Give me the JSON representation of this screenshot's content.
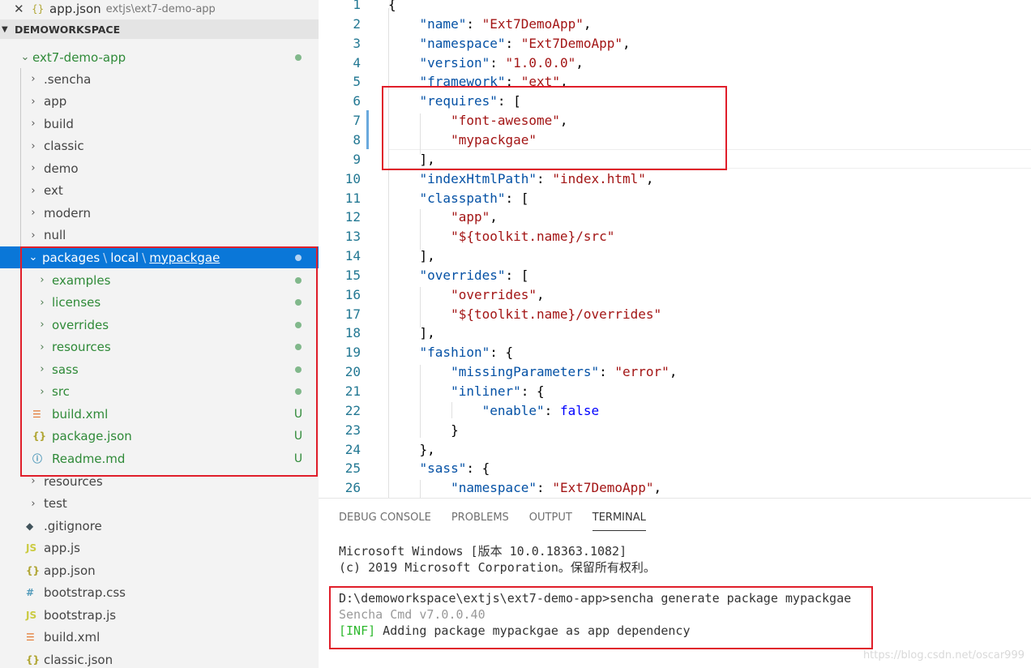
{
  "open_editor": {
    "name": "app.json",
    "path": "extjs\\ext7-demo-app"
  },
  "workspace": {
    "title": "DEMOWORKSPACE"
  },
  "tree": {
    "root": "ext7-demo-app",
    "folders_top": [
      ".sencha",
      "app",
      "build",
      "classic",
      "demo",
      "ext",
      "modern",
      "null"
    ],
    "selected": {
      "part1": "packages",
      "sep": "\\",
      "part2": "local",
      "part3": "mypackgae"
    },
    "package_children": [
      {
        "label": "examples",
        "status": "dot"
      },
      {
        "label": "licenses",
        "status": "dot"
      },
      {
        "label": "overrides",
        "status": "dot"
      },
      {
        "label": "resources",
        "status": "dot"
      },
      {
        "label": "sass",
        "status": "dot"
      },
      {
        "label": "src",
        "status": "dot"
      },
      {
        "label": "build.xml",
        "status": "U",
        "icon": "rss-icon"
      },
      {
        "label": "package.json",
        "status": "U",
        "icon": "json-icon",
        "icon_text": "{}"
      },
      {
        "label": "Readme.md",
        "status": "U",
        "icon": "info-icon",
        "icon_text": "ⓘ"
      }
    ],
    "folders_bottom": [
      "resources",
      "test"
    ],
    "files_bottom": [
      {
        "label": ".gitignore",
        "icon": "git-icon",
        "icon_text": "◆"
      },
      {
        "label": "app.js",
        "icon": "js-icon",
        "icon_text": "JS"
      },
      {
        "label": "app.json",
        "icon": "json-icon",
        "icon_text": "{}"
      },
      {
        "label": "bootstrap.css",
        "icon": "css-icon",
        "icon_text": "#"
      },
      {
        "label": "bootstrap.js",
        "icon": "js-icon",
        "icon_text": "JS"
      },
      {
        "label": "build.xml",
        "icon": "rss-icon",
        "icon_text": "☰"
      },
      {
        "label": "classic.json",
        "icon": "json-icon",
        "icon_text": "{}"
      }
    ]
  },
  "editor": {
    "lines": [
      "{",
      "    \"name\": \"Ext7DemoApp\",",
      "    \"namespace\": \"Ext7DemoApp\",",
      "    \"version\": \"1.0.0.0\",",
      "    \"framework\": \"ext\",",
      "    \"requires\": [",
      "        \"font-awesome\",",
      "        \"mypackgae\"",
      "    ],",
      "    \"indexHtmlPath\": \"index.html\",",
      "    \"classpath\": [",
      "        \"app\",",
      "        \"${toolkit.name}/src\"",
      "    ],",
      "    \"overrides\": [",
      "        \"overrides\",",
      "        \"${toolkit.name}/overrides\"",
      "    ],",
      "    \"fashion\": {",
      "        \"missingParameters\": \"error\",",
      "        \"inliner\": {",
      "            \"enable\": false",
      "        }",
      "    },",
      "    \"sass\": {",
      "        \"namespace\": \"Ext7DemoApp\","
    ]
  },
  "panel": {
    "tabs": [
      "DEBUG CONSOLE",
      "PROBLEMS",
      "OUTPUT",
      "TERMINAL"
    ],
    "active_tab": "TERMINAL",
    "terminal": {
      "line1": "Microsoft Windows [版本 10.0.18363.1082]",
      "line2": "(c) 2019 Microsoft Corporation。保留所有权利。",
      "line3": "D:\\demoworkspace\\extjs\\ext7-demo-app>sencha generate package mypackgae",
      "line4": "Sencha Cmd v7.0.0.40",
      "line5_tag": "[INF]",
      "line5_text": " Adding package mypackgae as app dependency"
    }
  },
  "watermark": "https://blog.csdn.net/oscar999",
  "colors": {
    "selection": "#0a77d8",
    "highlight_box": "#e01e2a",
    "git_added": "#2f8a38"
  }
}
